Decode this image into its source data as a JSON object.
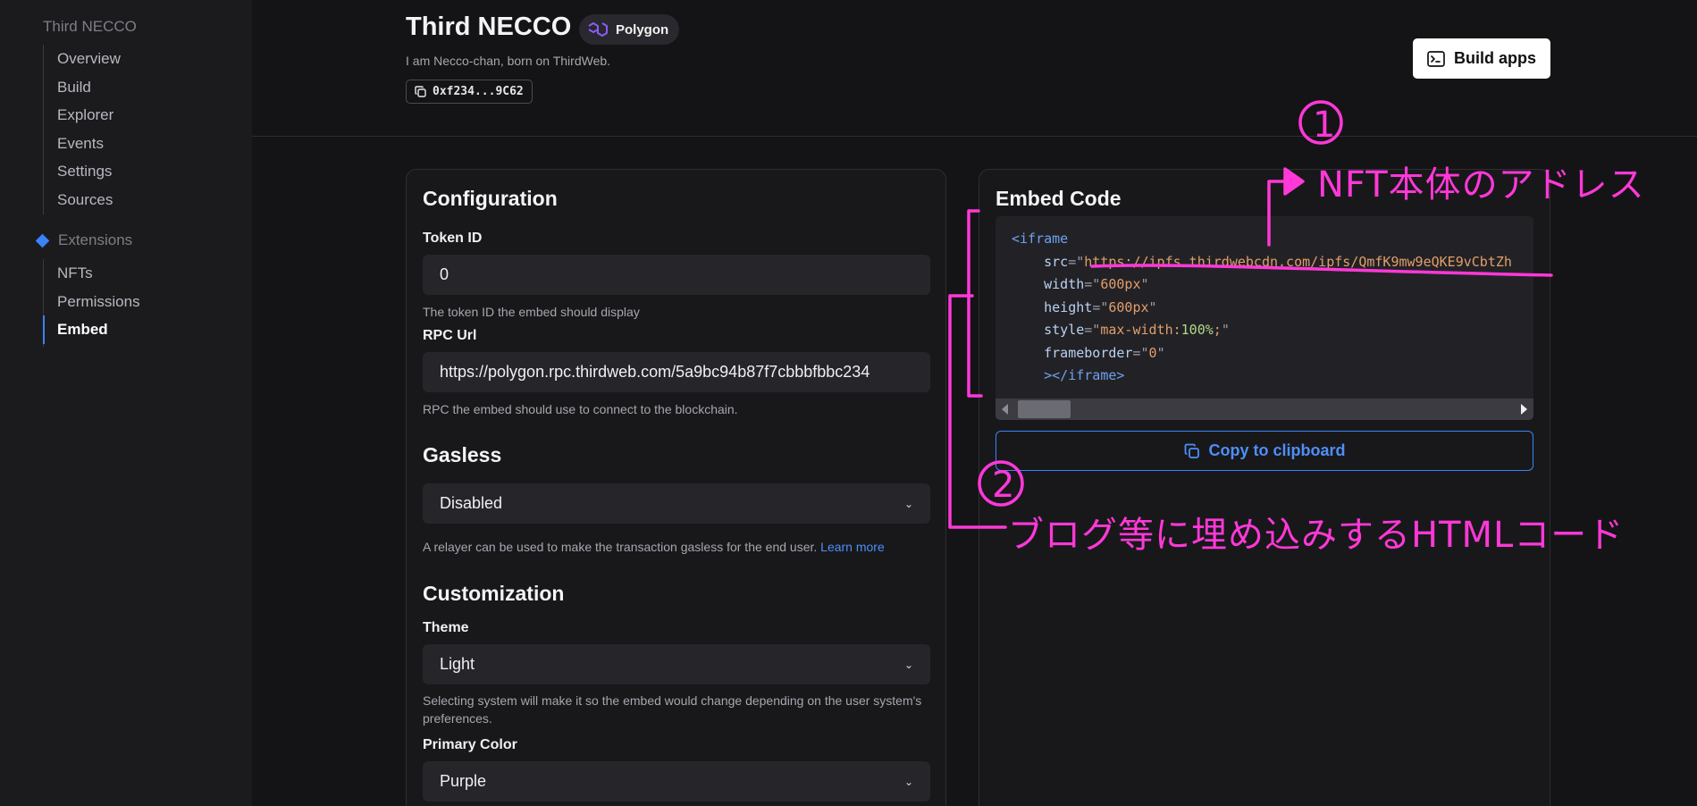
{
  "sidebar": {
    "heading": "Third NECCO",
    "items": [
      {
        "label": "Overview"
      },
      {
        "label": "Build"
      },
      {
        "label": "Explorer"
      },
      {
        "label": "Events"
      },
      {
        "label": "Settings"
      },
      {
        "label": "Sources"
      }
    ],
    "extensions_label": "Extensions",
    "extension_items": [
      {
        "label": "NFTs"
      },
      {
        "label": "Permissions"
      },
      {
        "label": "Embed",
        "active": true
      }
    ]
  },
  "header": {
    "title": "Third NECCO",
    "chain": "Polygon",
    "description": "I am Necco-chan, born on ThirdWeb.",
    "address": "0xf234...9C62",
    "build_button": "Build apps"
  },
  "config": {
    "heading": "Configuration",
    "token_id_label": "Token ID",
    "token_id_value": "0",
    "token_id_help": "The token ID the embed should display",
    "rpc_label": "RPC Url",
    "rpc_value": "https://polygon.rpc.thirdweb.com/5a9bc94b87f7cbbbfbbc234",
    "rpc_help": "RPC the embed should use to connect to the blockchain.",
    "gasless_heading": "Gasless",
    "gasless_value": "Disabled",
    "gasless_help": "A relayer can be used to make the transaction gasless for the end user.",
    "learn_more": "Learn more",
    "custom_heading": "Customization",
    "theme_label": "Theme",
    "theme_value": "Light",
    "theme_help": "Selecting system will make it so the embed would change depending on the user system's preferences.",
    "primary_color_label": "Primary Color",
    "primary_color_value": "Purple"
  },
  "embed": {
    "heading": "Embed Code",
    "code": {
      "open_tag": "<iframe",
      "src_attr": "src",
      "src_value": "https://ipfs.thirdwebcdn.com/ipfs/QmfK9mw9eQKE9vCbtZh",
      "width_attr": "width",
      "width_value": "600px",
      "height_attr": "height",
      "height_value": "600px",
      "style_attr": "style",
      "style_prop": "max-width:",
      "style_num": "100%",
      "style_end": ";",
      "frameborder_attr": "frameborder",
      "frameborder_value": "0",
      "close_tag": "></iframe>"
    },
    "copy_button": "Copy to clipboard"
  },
  "annotations": {
    "circle_1": "1",
    "note_1": "NFT本体のアドレス",
    "circle_2": "2",
    "note_2": "ブログ等に埋め込みするHTMLコード",
    "color": "#ff38d7"
  }
}
